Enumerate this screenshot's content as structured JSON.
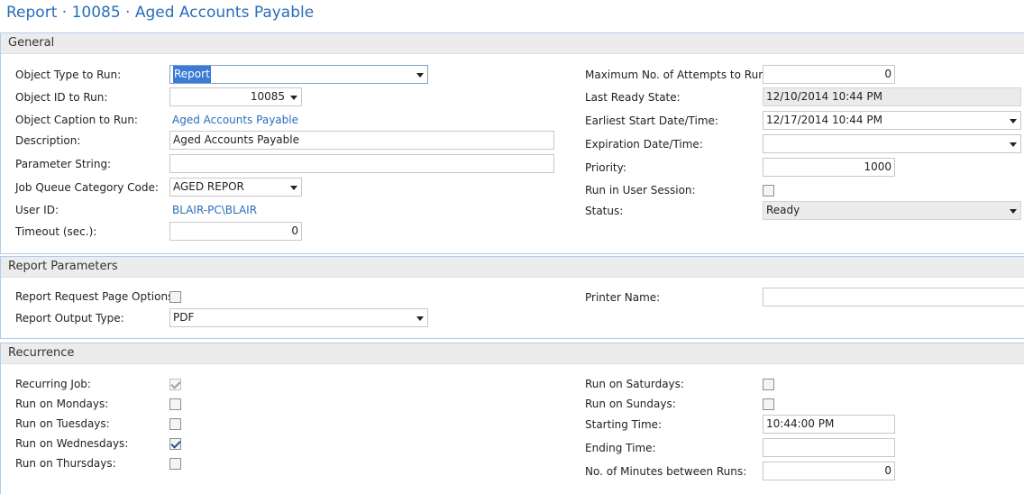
{
  "page": {
    "title": "Report · 10085 · Aged Accounts Payable"
  },
  "general": {
    "title": "General",
    "object_type": {
      "label": "Object Type to Run:",
      "value": "Report"
    },
    "object_id": {
      "label": "Object ID to Run:",
      "value": "10085"
    },
    "object_caption": {
      "label": "Object Caption to Run:",
      "value": "Aged Accounts Payable"
    },
    "description": {
      "label": "Description:",
      "value": "Aged Accounts Payable"
    },
    "parameter_string": {
      "label": "Parameter String:",
      "value": ""
    },
    "job_queue_category": {
      "label": "Job Queue Category Code:",
      "value": "AGED REPOR"
    },
    "user_id": {
      "label": "User ID:",
      "value": "BLAIR-PC\\BLAIR"
    },
    "timeout": {
      "label": "Timeout (sec.):",
      "value": "0"
    },
    "max_attempts": {
      "label": "Maximum No. of Attempts to Run:",
      "value": "0"
    },
    "last_ready_state": {
      "label": "Last Ready State:",
      "value": "12/10/2014 10:44 PM"
    },
    "earliest_start": {
      "label": "Earliest Start Date/Time:",
      "value": "12/17/2014 10:44 PM"
    },
    "expiration": {
      "label": "Expiration Date/Time:",
      "value": ""
    },
    "priority": {
      "label": "Priority:",
      "value": "1000"
    },
    "run_in_user_session": {
      "label": "Run in User Session:",
      "checked": false
    },
    "status": {
      "label": "Status:",
      "value": "Ready"
    }
  },
  "report_parameters": {
    "title": "Report Parameters",
    "request_page_options": {
      "label": "Report Request Page Options:",
      "checked": false
    },
    "output_type": {
      "label": "Report Output Type:",
      "value": "PDF"
    },
    "printer_name": {
      "label": "Printer Name:",
      "value": ""
    }
  },
  "recurrence": {
    "title": "Recurrence",
    "recurring_job": {
      "label": "Recurring Job:",
      "checked": true
    },
    "mondays": {
      "label": "Run on Mondays:",
      "checked": false
    },
    "tuesdays": {
      "label": "Run on Tuesdays:",
      "checked": false
    },
    "wednesdays": {
      "label": "Run on Wednesdays:",
      "checked": true
    },
    "thursdays": {
      "label": "Run on Thursdays:",
      "checked": false
    },
    "saturdays": {
      "label": "Run on Saturdays:",
      "checked": false
    },
    "sundays": {
      "label": "Run on Sundays:",
      "checked": false
    },
    "starting_time": {
      "label": "Starting Time:",
      "value": "10:44:00 PM"
    },
    "ending_time": {
      "label": "Ending Time:",
      "value": ""
    },
    "minutes_between_runs": {
      "label": "No. of Minutes between Runs:",
      "value": "0"
    }
  }
}
